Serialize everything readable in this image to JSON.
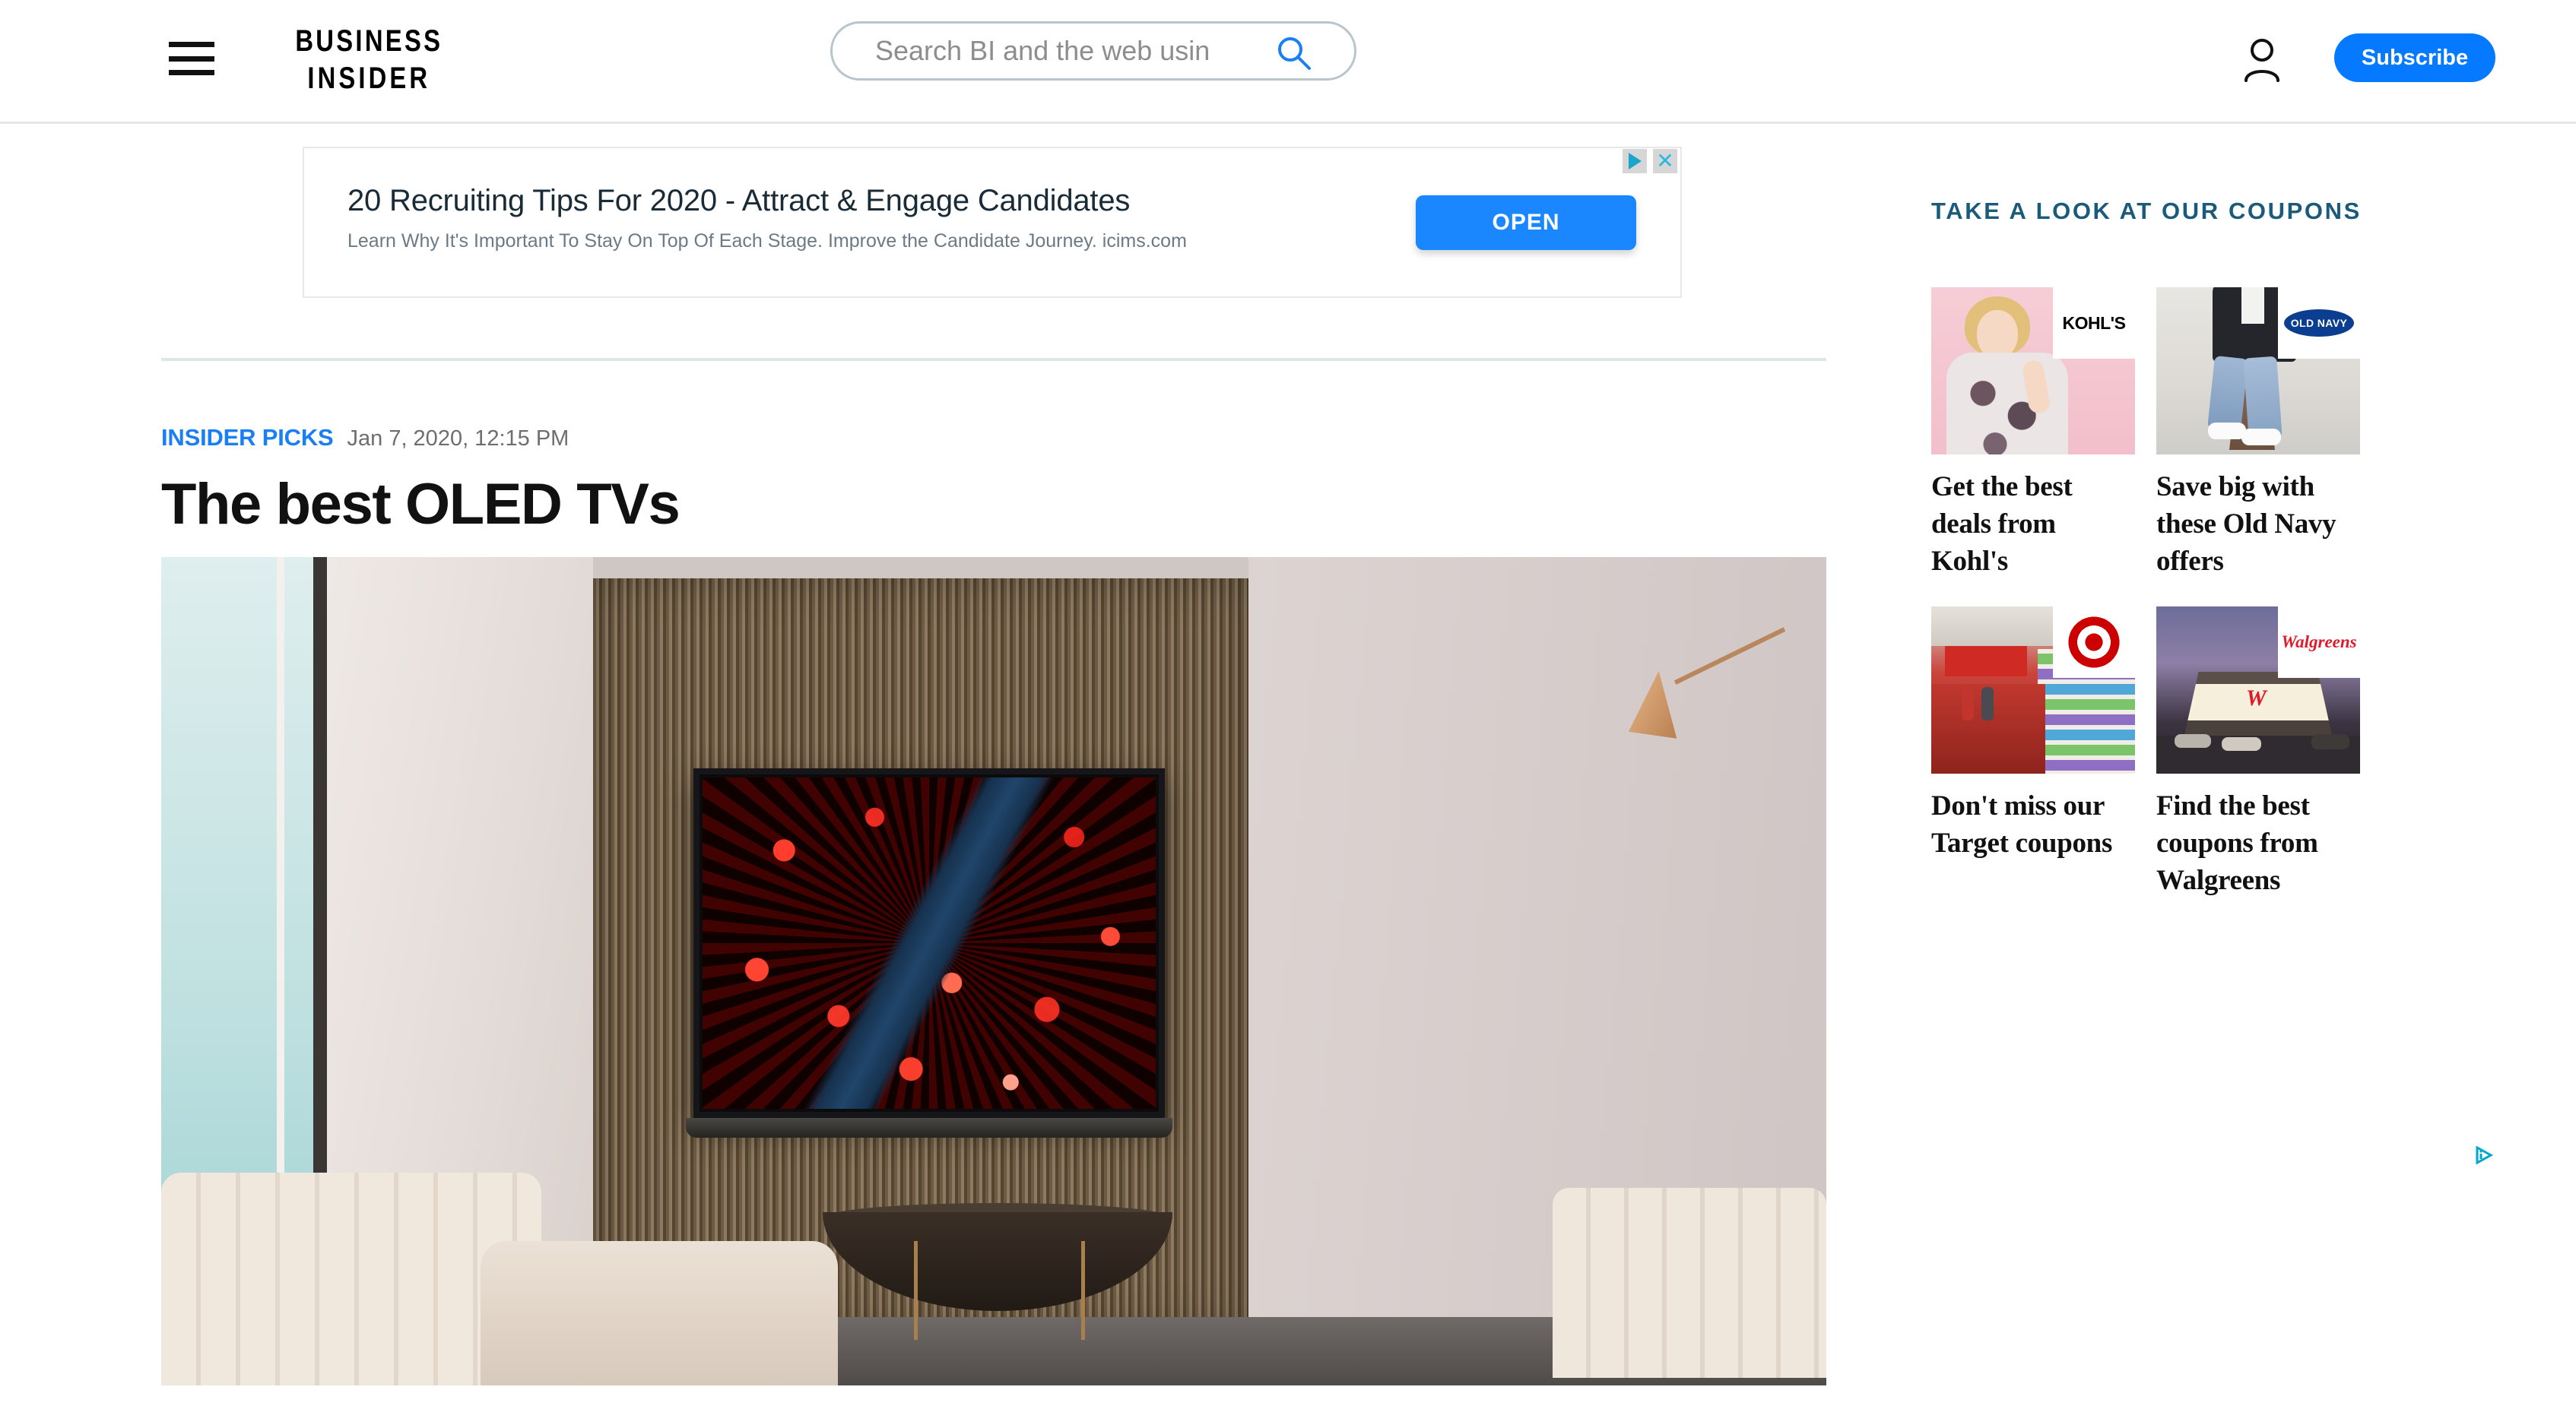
{
  "header": {
    "menu_icon": "hamburger-menu-icon",
    "logo_line1": "BUSINESS",
    "logo_line2": "INSIDER",
    "search": {
      "placeholder": "Search BI and the web usin",
      "value": "",
      "icon": "search-icon"
    },
    "account_icon": "account-person-icon",
    "subscribe_label": "Subscribe",
    "subscribe_color": "#0579ff"
  },
  "ad": {
    "headline": "20 Recruiting Tips For 2020 - Attract & Engage Candidates",
    "description": "Learn Why It's Important To Stay On Top Of Each Stage. Improve the Candidate Journey. icims.com",
    "cta_label": "OPEN",
    "cta_color": "#1a86ff",
    "adchoices_icon": "adchoices-icon",
    "close_icon": "close-x-icon"
  },
  "article": {
    "kicker": "INSIDER PICKS",
    "kicker_color": "#1a7ff5",
    "timestamp": "Jan 7, 2020, 12:15 PM",
    "headline": "The best OLED TVs",
    "hero_image_alt": "Living room with wall-mounted OLED TV showing red autumn foliage"
  },
  "sidebar": {
    "title": "TAKE A LOOK AT OUR COUPONS",
    "title_color": "#1a5b7c",
    "coupons": [
      {
        "label": "Get the best deals from Kohl's",
        "brand": "KOHL'S",
        "logo_name": "kohls-logo"
      },
      {
        "label": "Save big with these Old Navy offers",
        "brand": "OLD NAVY",
        "logo_name": "old-navy-logo"
      },
      {
        "label": "Don't miss our Target coupons",
        "brand": "TARGET",
        "logo_name": "target-logo"
      },
      {
        "label": "Find the best coupons from Walgreens",
        "brand": "Walgreens",
        "logo_name": "walgreens-logo"
      }
    ]
  },
  "footer_ad": {
    "adchoices_icon": "adchoices-icon"
  }
}
